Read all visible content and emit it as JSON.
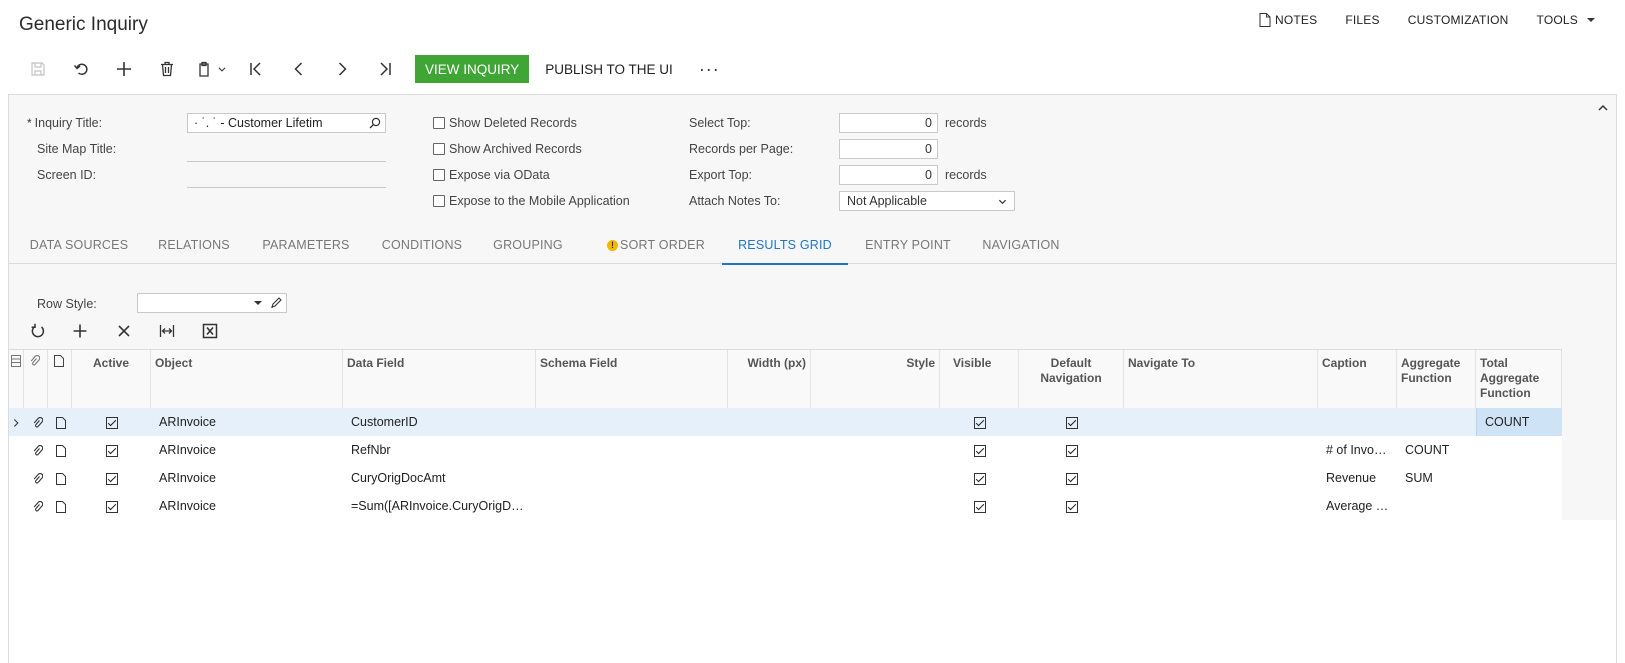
{
  "app": {
    "title": "Generic Inquiry"
  },
  "top_links": {
    "notes": "NOTES",
    "files": "FILES",
    "customization": "CUSTOMIZATION",
    "tools": "TOOLS"
  },
  "toolbar": {
    "view_inquiry": "VIEW INQUIRY",
    "publish": "PUBLISH TO THE UI",
    "more": "···"
  },
  "form": {
    "inquiry_title_label": "Inquiry Title:",
    "inquiry_title_value": "·    ˙.       ˙ - Customer Lifetim",
    "site_map_title_label": "Site Map Title:",
    "screen_id_label": "Screen ID:",
    "show_deleted": "Show Deleted Records",
    "show_archived": "Show Archived Records",
    "expose_odata": "Expose via OData",
    "expose_mobile": "Expose to the Mobile Application",
    "select_top_label": "Select Top:",
    "select_top_value": "0",
    "select_top_unit": "records",
    "records_per_page_label": "Records per Page:",
    "records_per_page_value": "0",
    "export_top_label": "Export Top:",
    "export_top_value": "0",
    "export_top_unit": "records",
    "attach_notes_label": "Attach Notes To:",
    "attach_notes_value": "Not Applicable"
  },
  "tabs": [
    "DATA SOURCES",
    "RELATIONS",
    "PARAMETERS",
    "CONDITIONS",
    "GROUPING",
    "SORT ORDER",
    "RESULTS GRID",
    "ENTRY POINT",
    "NAVIGATION"
  ],
  "active_tab": "RESULTS GRID",
  "row_style": {
    "label": "Row Style:"
  },
  "grid": {
    "headers": {
      "active": "Active",
      "object": "Object",
      "data_field": "Data Field",
      "schema_field": "Schema Field",
      "width": "Width (px)",
      "style": "Style",
      "visible": "Visible",
      "default_nav": "Default Navigation",
      "navigate_to": "Navigate To",
      "caption": "Caption",
      "aggregate": "Aggregate Function",
      "total_aggregate": "Total Aggregate Function"
    },
    "rows": [
      {
        "object": "ARInvoice",
        "data_field": "CustomerID",
        "caption": "",
        "aggregate": "",
        "total_aggregate": "COUNT"
      },
      {
        "object": "ARInvoice",
        "data_field": "RefNbr",
        "caption": "# of Invo…",
        "aggregate": "COUNT",
        "total_aggregate": ""
      },
      {
        "object": "ARInvoice",
        "data_field": "CuryOrigDocAmt",
        "caption": "Revenue",
        "aggregate": "SUM",
        "total_aggregate": ""
      },
      {
        "object": "ARInvoice",
        "data_field": "=Sum([ARInvoice.CuryOrigD…",
        "caption": "Average …",
        "aggregate": "",
        "total_aggregate": ""
      }
    ]
  },
  "colors": {
    "accent": "#1d76c6",
    "green": "#3fa534",
    "selected_row": "#e6f0fa"
  }
}
